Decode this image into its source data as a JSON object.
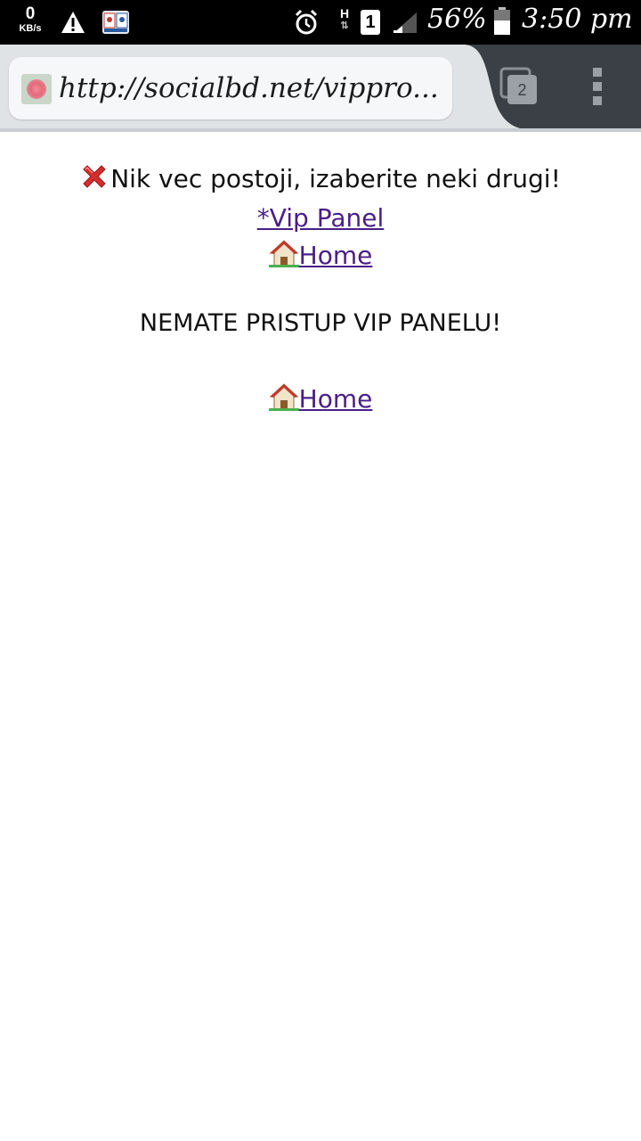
{
  "status_bar": {
    "speed_value": "0",
    "speed_unit": "KB/s",
    "sim_slot": "1",
    "network_type": "H",
    "battery_percent": "56%",
    "time": "3:50 pm",
    "icons": [
      "warning-icon",
      "book-app-icon",
      "alarm-icon",
      "signal-icon",
      "battery-icon"
    ]
  },
  "browser": {
    "url": "http://socialbd.net/vippro...",
    "tab_count": "2",
    "colors": {
      "toolbar": "#dfe3e6",
      "tab_switcher_area": "#3a4045",
      "url_bar": "#f6f7f9"
    }
  },
  "page": {
    "error_message": "Nik vec postoji, izaberite neki drugi!",
    "vip_panel_link": "*Vip Panel",
    "home_link_1": "Home",
    "notice": "NEMATE PRISTUP VIP PANELU!",
    "home_link_2": "Home",
    "colors": {
      "link": "#4a1f86",
      "text": "#111111"
    }
  }
}
